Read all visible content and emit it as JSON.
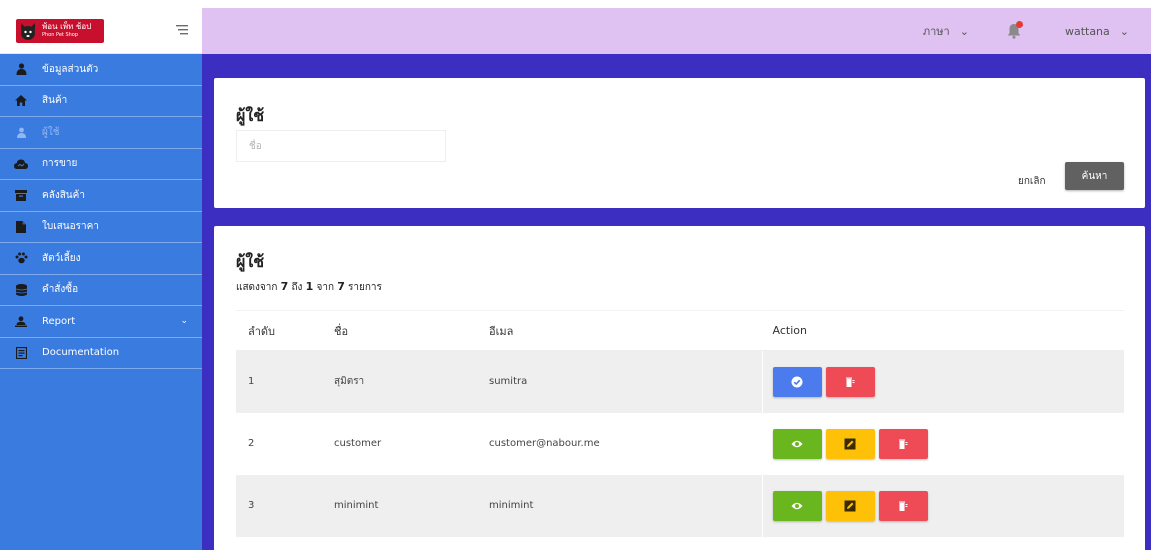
{
  "brand": {
    "logo_text": "พ้อน เพ็ท ช้อป",
    "logo_subtext": "Phon Pet Shop"
  },
  "sidebar": {
    "items": [
      {
        "label": "ข้อมูลส่วนตัว",
        "icon": "user-icon"
      },
      {
        "label": "สินค้า",
        "icon": "home-icon"
      },
      {
        "label": "ผู้ใช้",
        "icon": "users-icon"
      },
      {
        "label": "การขาย",
        "icon": "cloud-icon"
      },
      {
        "label": "คลังสินค้า",
        "icon": "archive-icon"
      },
      {
        "label": "ใบเสนอราคา",
        "icon": "document-icon"
      },
      {
        "label": "สัตว์เลี้ยง",
        "icon": "paw-icon"
      },
      {
        "label": "คำสั่งซื้อ",
        "icon": "database-icon"
      },
      {
        "label": "Report",
        "icon": "person-icon"
      },
      {
        "label": "Documentation",
        "icon": "book-icon"
      }
    ]
  },
  "topbar": {
    "language_label": "ภาษา",
    "username": "wattana"
  },
  "search_panel": {
    "title": "ผู้ใช้",
    "input_placeholder": "ชื่อ",
    "cancel_label": "ยกเลิก",
    "search_label": "ค้นหา"
  },
  "table_panel": {
    "title": "ผู้ใช้",
    "summary_prefix": "แสดงจาก",
    "summary_from": "7",
    "summary_to_word": "ถึง",
    "summary_to": "1",
    "summary_of_word": "จาก",
    "summary_total": "7",
    "summary_suffix": "รายการ",
    "columns": [
      "ลำดับ",
      "ชื่อ",
      "อีเมล",
      "Action"
    ],
    "rows": [
      {
        "no": "1",
        "name": "สุมิตรา",
        "email": "sumitra",
        "actions": [
          "approve",
          "delete"
        ]
      },
      {
        "no": "2",
        "name": "customer",
        "email": "customer@nabour.me",
        "actions": [
          "view",
          "edit",
          "delete"
        ]
      },
      {
        "no": "3",
        "name": "minimint",
        "email": "minimint",
        "actions": [
          "view",
          "edit",
          "delete"
        ]
      }
    ]
  },
  "colors": {
    "sidebar": "#3a7be0",
    "topbar": "#dfc2f2",
    "main_bg": "#3c2ec0",
    "approve": "#4b7bec",
    "delete": "#ef4b56",
    "view": "#6ab61f",
    "edit": "#ffc107"
  }
}
